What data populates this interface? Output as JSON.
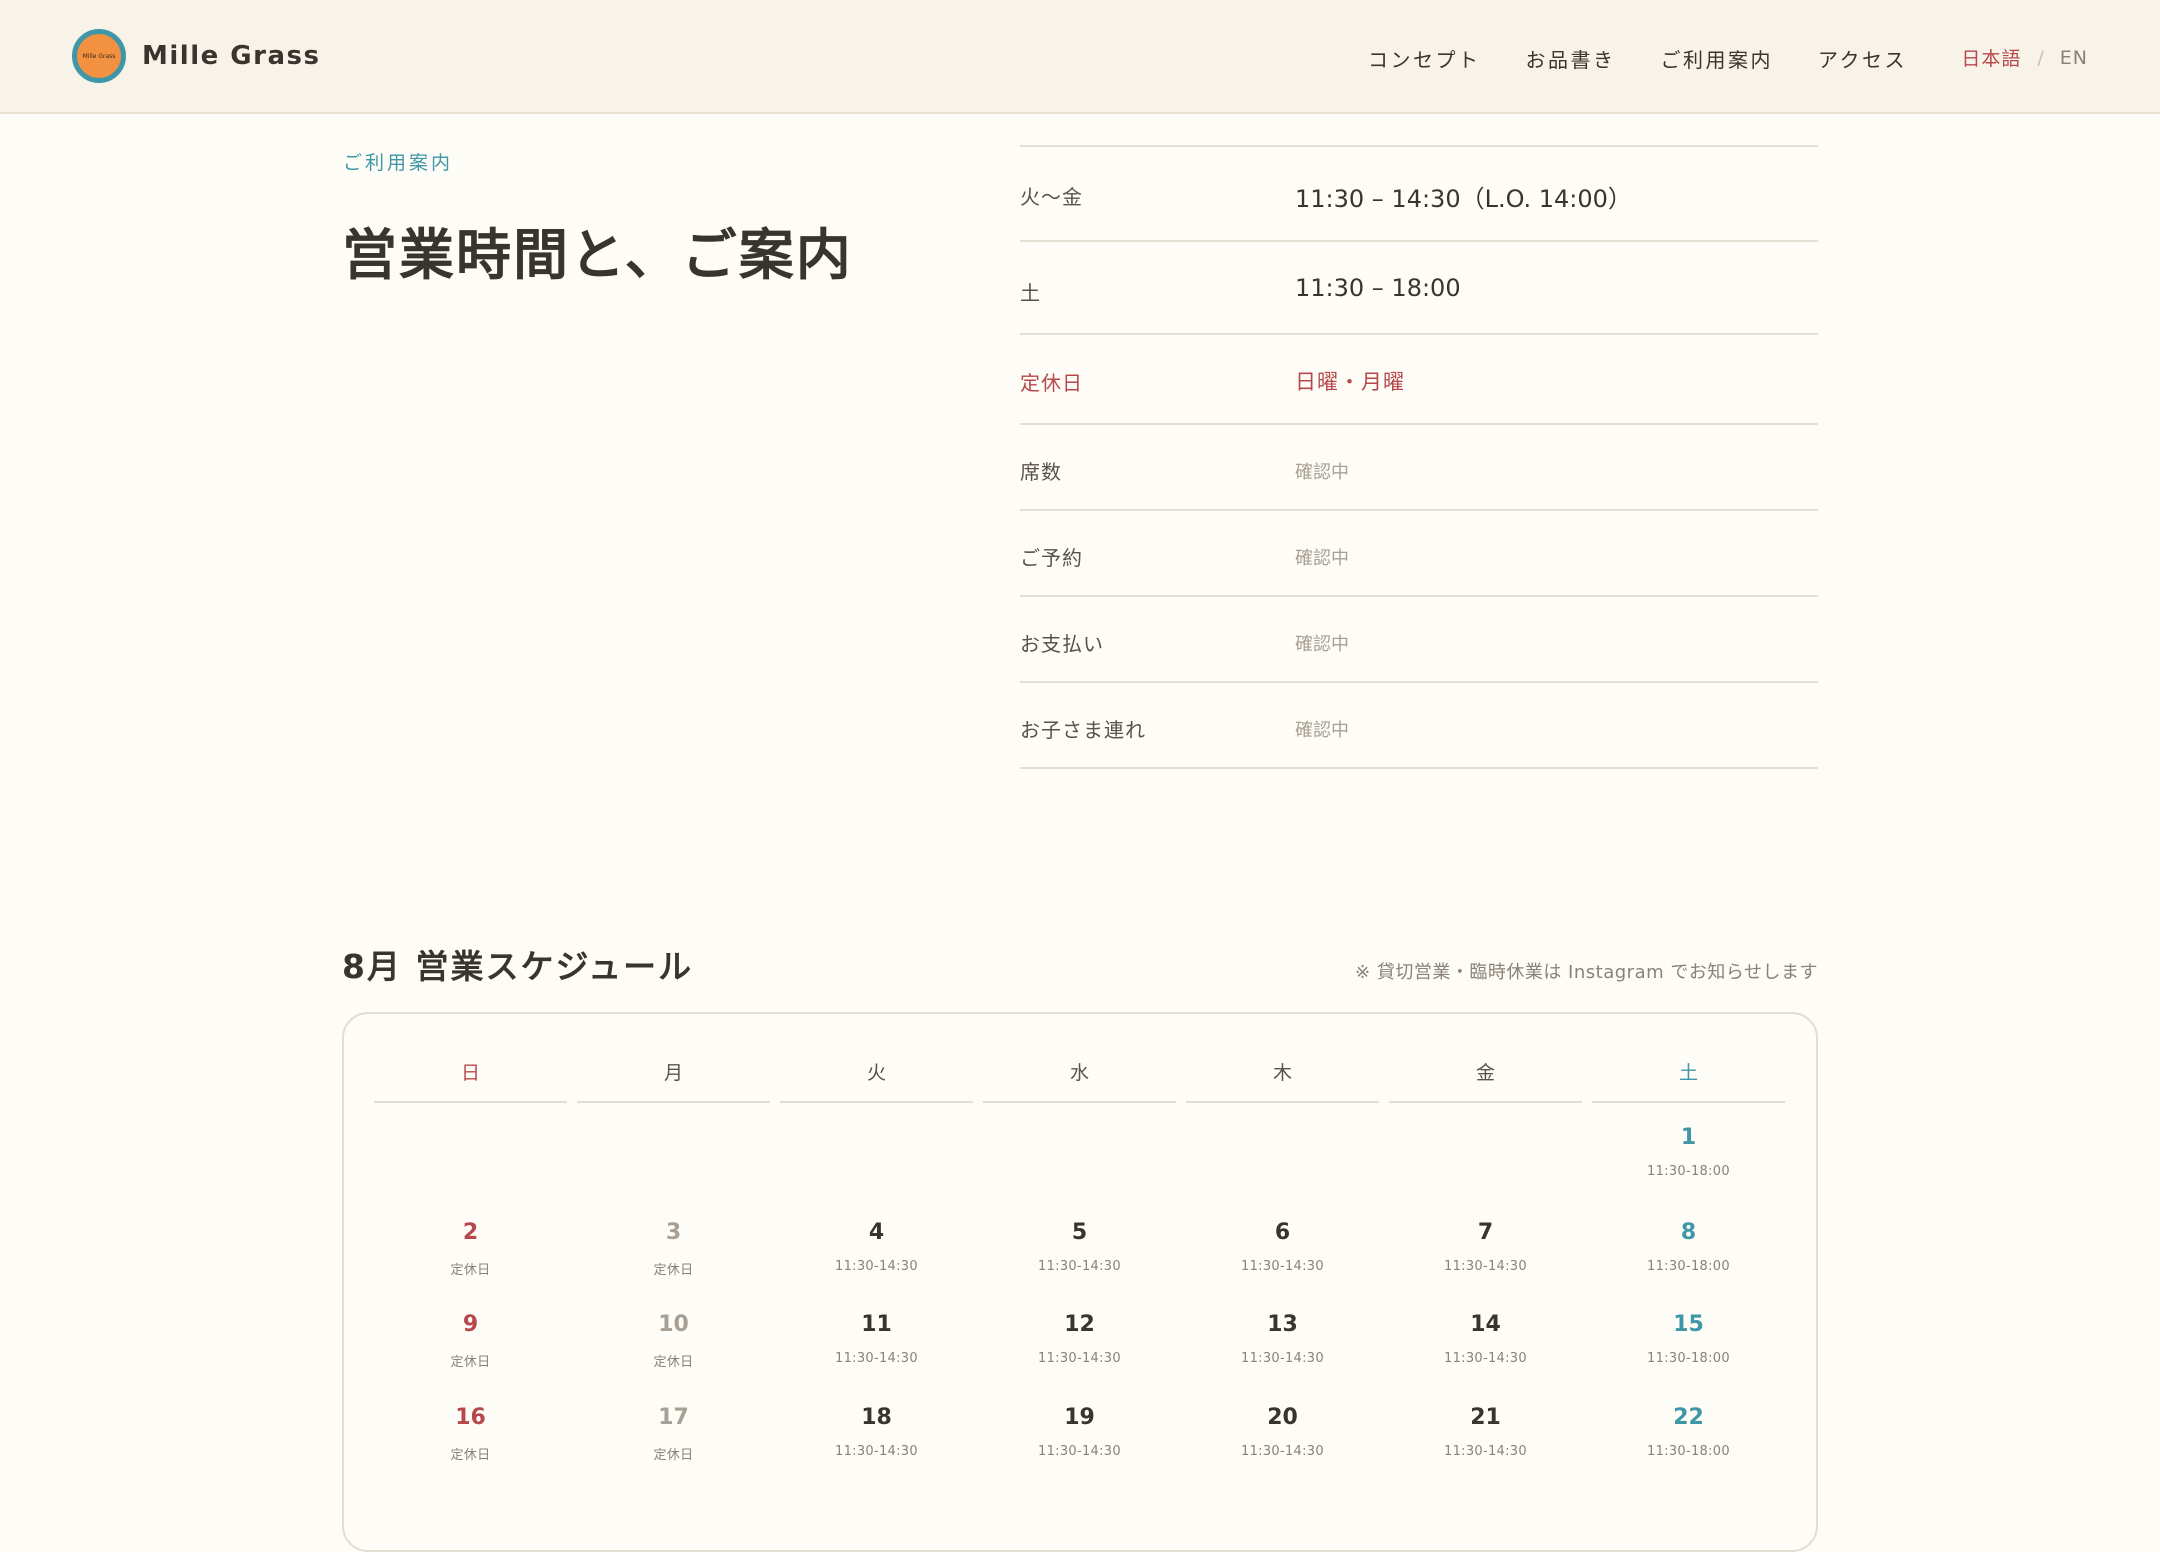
{
  "header": {
    "logo_text": "Mille Grass",
    "brand": "Mille Grass",
    "nav": [
      {
        "label": "コンセプト"
      },
      {
        "label": "お品書き"
      },
      {
        "label": "ご利用案内"
      },
      {
        "label": "アクセス"
      }
    ],
    "lang": {
      "ja": "日本語",
      "sep": "/",
      "en": "EN"
    }
  },
  "intro": {
    "eyebrow": "ご利用案内",
    "title": "営業時間と、ご案内"
  },
  "info_rows": [
    {
      "label": "火〜金",
      "value": "11:30 – 14:30（L.O. 14:00）"
    },
    {
      "label": "土",
      "value": "11:30 – 18:00"
    },
    {
      "label": "定休日",
      "value": "日曜・月曜"
    },
    {
      "label": "席数",
      "value": "確認中"
    },
    {
      "label": "ご予約",
      "value": "確認中"
    },
    {
      "label": "お支払い",
      "value": "確認中"
    },
    {
      "label": "お子さま連れ",
      "value": "確認中"
    }
  ],
  "schedule": {
    "title": "8月 営業スケジュール",
    "note": "※ 貸切営業・臨時休業は Instagram でお知らせします",
    "weekdays": [
      "日",
      "月",
      "火",
      "水",
      "木",
      "金",
      "土"
    ],
    "weeks": [
      [
        null,
        null,
        null,
        null,
        null,
        null,
        {
          "day": "1",
          "hours": "11:30-18:00"
        }
      ],
      [
        {
          "day": "2",
          "hours": "定休日"
        },
        {
          "day": "3",
          "hours": "定休日"
        },
        {
          "day": "4",
          "hours": "11:30-14:30"
        },
        {
          "day": "5",
          "hours": "11:30-14:30"
        },
        {
          "day": "6",
          "hours": "11:30-14:30"
        },
        {
          "day": "7",
          "hours": "11:30-14:30"
        },
        {
          "day": "8",
          "hours": "11:30-18:00"
        }
      ],
      [
        {
          "day": "9",
          "hours": "定休日"
        },
        {
          "day": "10",
          "hours": "定休日"
        },
        {
          "day": "11",
          "hours": "11:30-14:30"
        },
        {
          "day": "12",
          "hours": "11:30-14:30"
        },
        {
          "day": "13",
          "hours": "11:30-14:30"
        },
        {
          "day": "14",
          "hours": "11:30-14:30"
        },
        {
          "day": "15",
          "hours": "11:30-18:00"
        }
      ],
      [
        {
          "day": "16",
          "hours": "定休日"
        },
        {
          "day": "17",
          "hours": "定休日"
        },
        {
          "day": "18",
          "hours": "11:30-14:30"
        },
        {
          "day": "19",
          "hours": "11:30-14:30"
        },
        {
          "day": "20",
          "hours": "11:30-14:30"
        },
        {
          "day": "21",
          "hours": "11:30-14:30"
        },
        {
          "day": "22",
          "hours": "11:30-18:00"
        }
      ]
    ]
  },
  "colors": {
    "background": "#fefcf6",
    "header_bg": "#f8f3e8",
    "accent_teal": "#3f96a6",
    "accent_red": "#b5484a",
    "logo_orange": "#f2913f"
  }
}
